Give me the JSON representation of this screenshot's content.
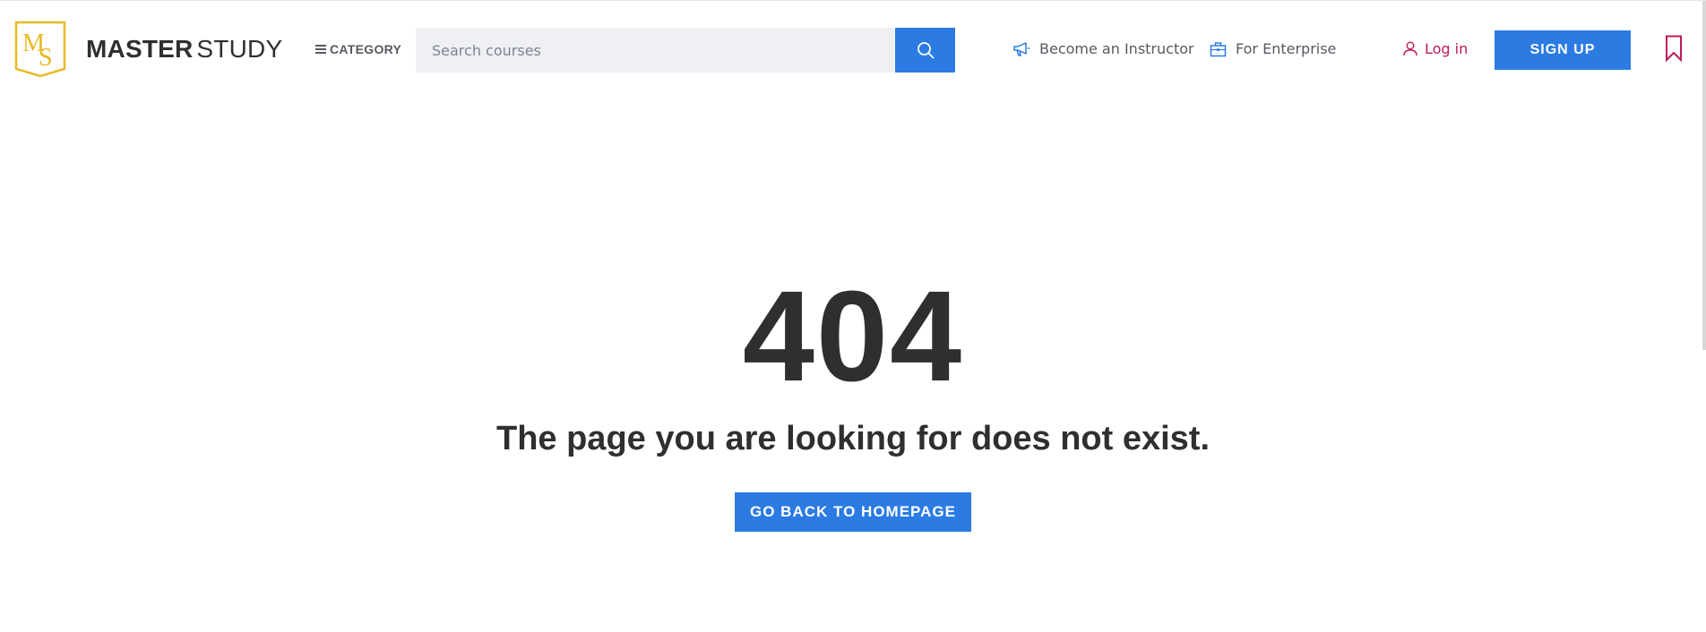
{
  "header": {
    "logo_letters": "MS",
    "brand_bold": "MASTER",
    "brand_regular": "STUDY",
    "category_label": "CATEGORY",
    "search": {
      "placeholder": "Search courses",
      "value": ""
    },
    "become_instructor": "Become an Instructor",
    "for_enterprise": "For Enterprise",
    "login": "Log in",
    "signup": "SIGN UP"
  },
  "main": {
    "error_code": "404",
    "message": "The page you are looking for does not exist.",
    "home_button": "GO BACK TO HOMEPAGE"
  },
  "colors": {
    "accent": "#2b7be3",
    "login": "#c2185b",
    "logo": "#e8b923",
    "text_dark": "#2f2f2f"
  },
  "icons": [
    "logo-icon",
    "menu-icon",
    "search-icon",
    "megaphone-icon",
    "briefcase-icon",
    "user-icon",
    "bookmark-icon"
  ]
}
